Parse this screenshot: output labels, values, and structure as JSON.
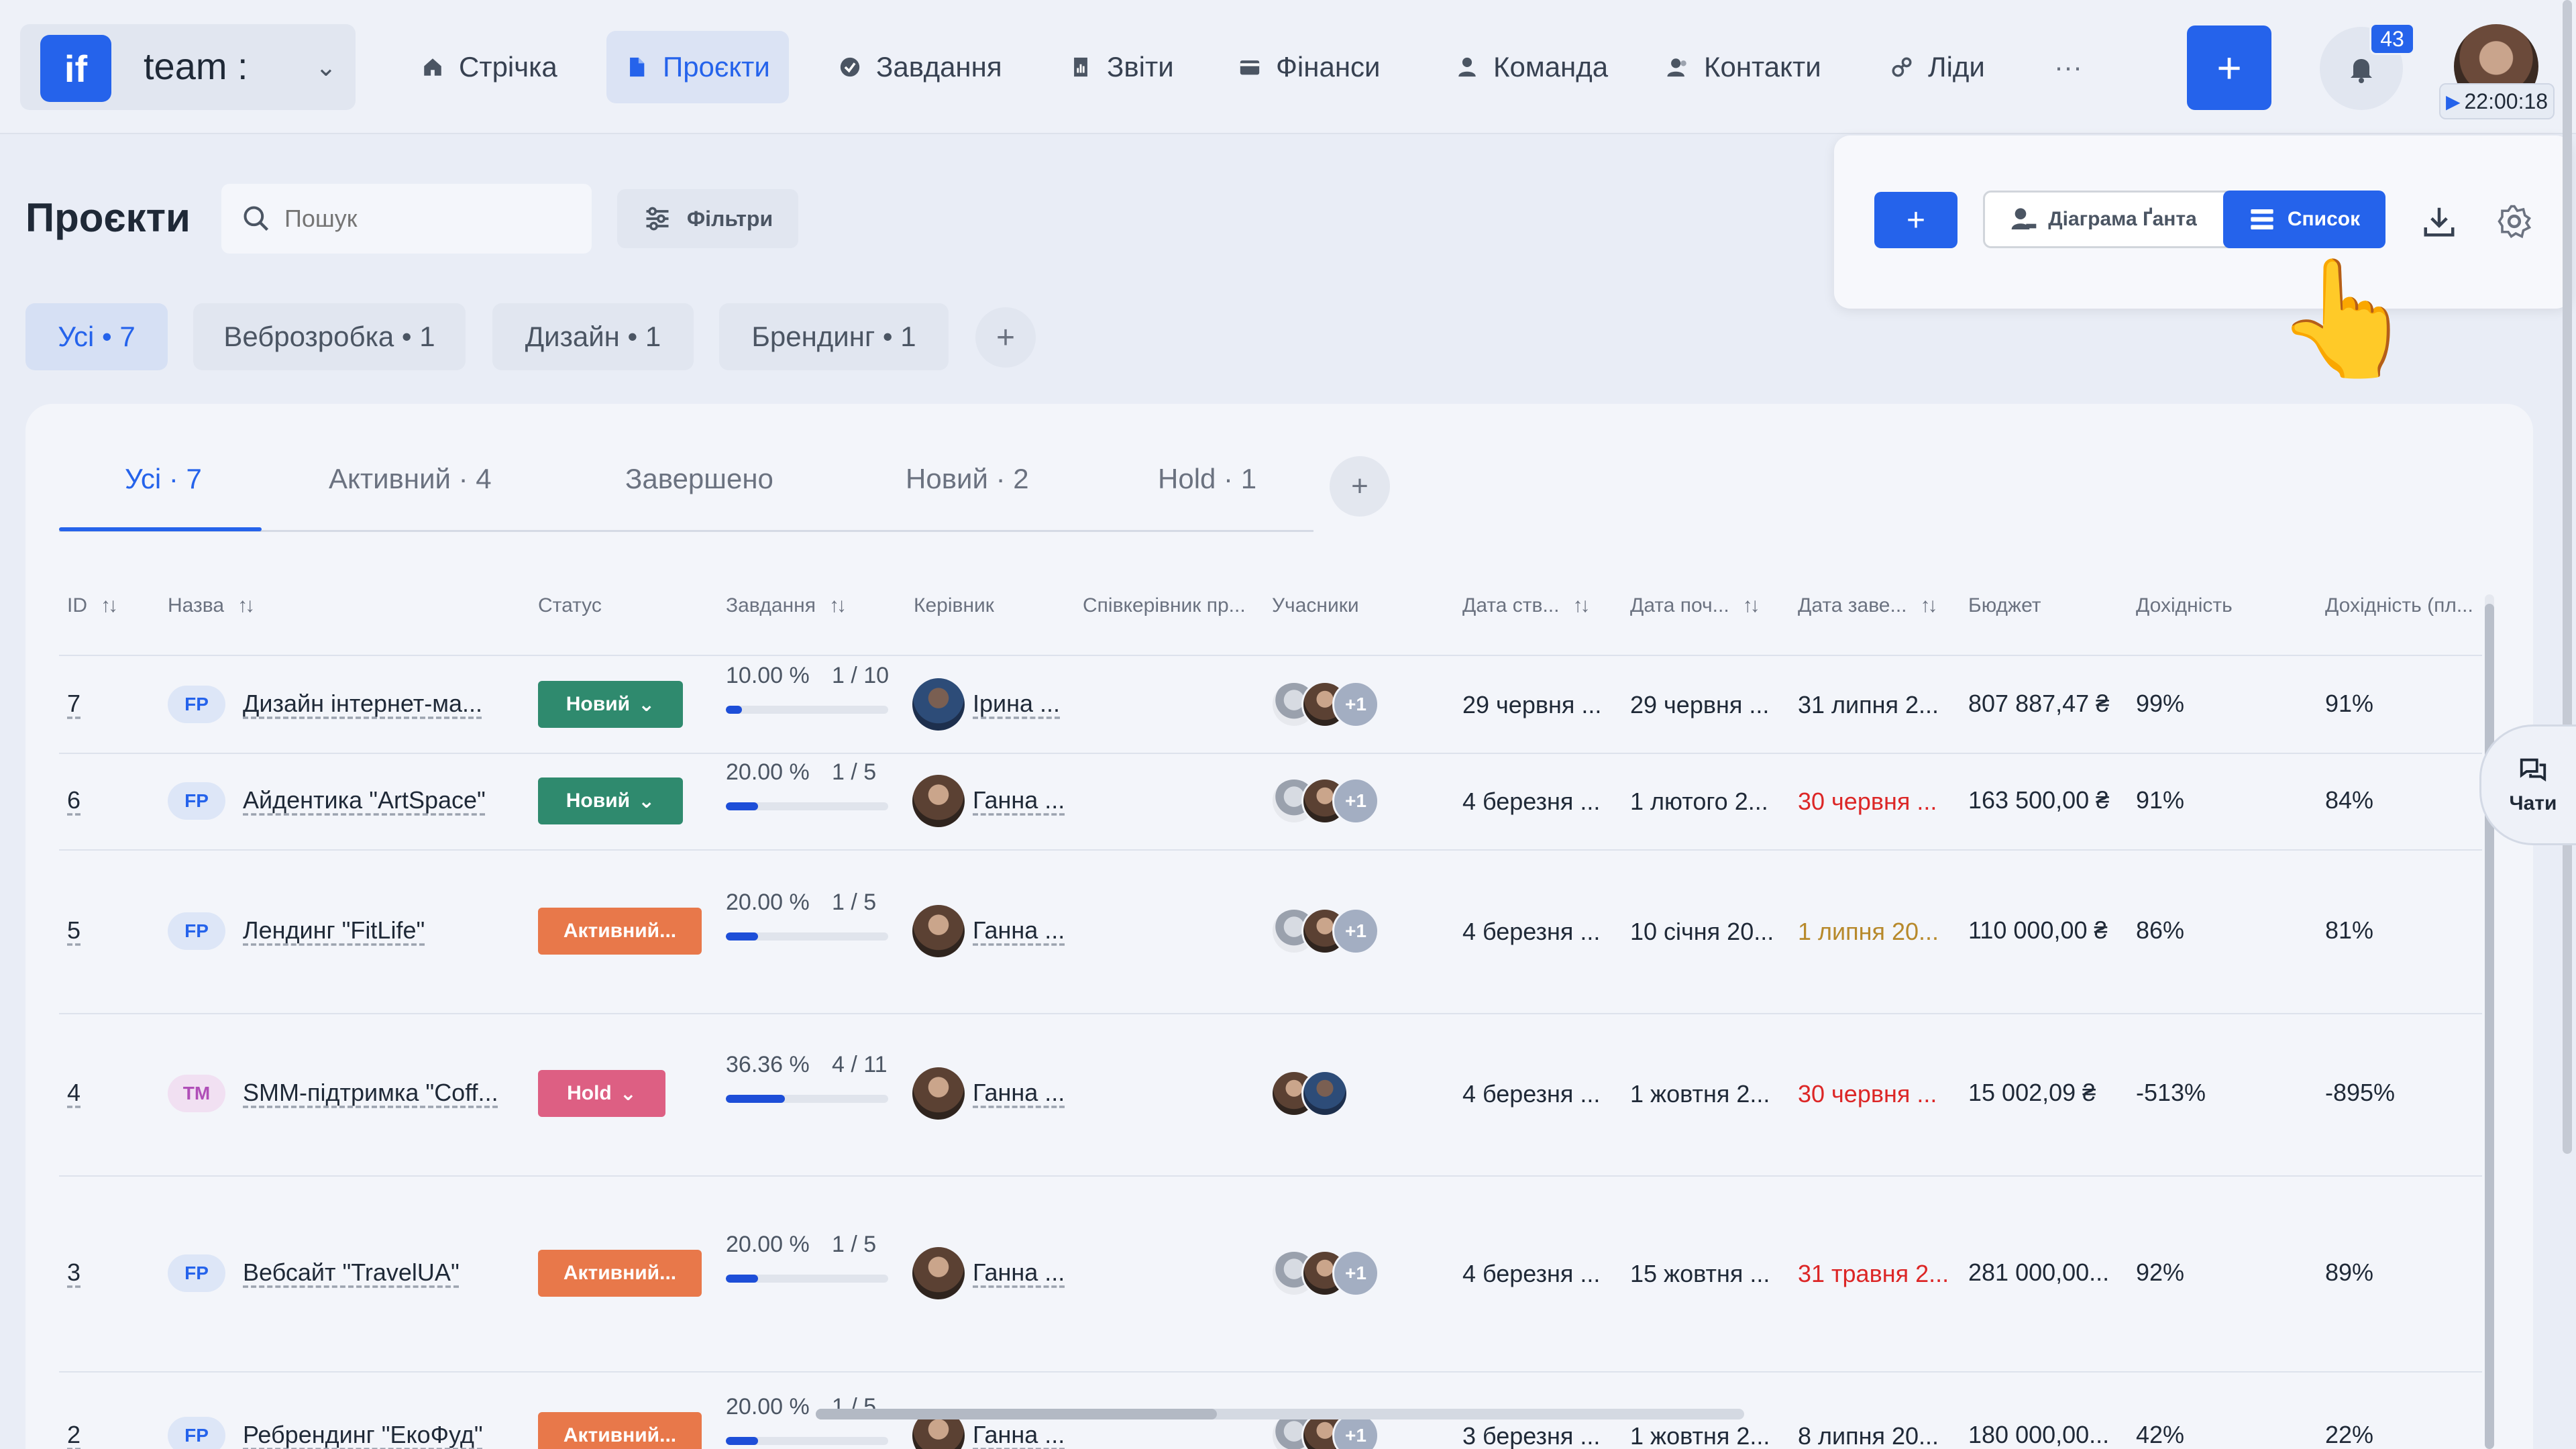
{
  "workspace": {
    "logo": "if",
    "name": "team :"
  },
  "nav": [
    {
      "label": "Стрічка",
      "icon": "home-icon"
    },
    {
      "label": "Проєкти",
      "icon": "document-icon",
      "active": true
    },
    {
      "label": "Завдання",
      "icon": "check-circle-icon"
    },
    {
      "label": "Звіти",
      "icon": "report-icon"
    },
    {
      "label": "Фінанси",
      "icon": "wallet-icon"
    },
    {
      "label": "Команда",
      "icon": "user-icon"
    },
    {
      "label": "Контакти",
      "icon": "contacts-icon"
    },
    {
      "label": "Ліди",
      "icon": "leads-icon"
    },
    {
      "label": "···",
      "icon": "more-icon"
    }
  ],
  "header_right": {
    "add_label": "+",
    "notifications": "43",
    "timer": "22:00:18"
  },
  "page": {
    "title": "Проєкти",
    "search_placeholder": "Пошук",
    "filters_label": "Фільтри",
    "add_label": "+",
    "gantt_label": "Діаграма Ґанта",
    "list_label": "Список"
  },
  "categories": [
    {
      "label": "Усі • 7",
      "active": true
    },
    {
      "label": "Веброзробка • 1"
    },
    {
      "label": "Дизайн • 1"
    },
    {
      "label": "Брендинг • 1"
    }
  ],
  "category_add": "+",
  "status_tabs": [
    {
      "label": "Усі · 7",
      "active": true
    },
    {
      "label": "Активний · 4"
    },
    {
      "label": "Завершено"
    },
    {
      "label": "Новий · 2"
    },
    {
      "label": "Hold · 1"
    }
  ],
  "status_tab_add": "+",
  "columns": [
    "ID",
    "Назва",
    "Статус",
    "Завдання",
    "Керівник",
    "Співкерівник пр...",
    "Учасники",
    "Дата ств...",
    "Дата поч...",
    "Дата заве...",
    "Бюджет",
    "Дохідність",
    "Дохідність (пл..."
  ],
  "rows": [
    {
      "id": "7",
      "tag": "FP",
      "name": "Дизайн інтернет-ма...",
      "status": "Новий",
      "progress_text": "10.00 %",
      "tasks": "1 / 10",
      "progress": 0.1,
      "manager": "Ірина ...",
      "participants_more": "+1",
      "created": "29 червня ...",
      "start": "29 червня ...",
      "end": "31 липня 2...",
      "budget": "807 887,47 ₴",
      "profit": "99%",
      "profit_plan": "91%"
    },
    {
      "id": "6",
      "tag": "FP",
      "name": "Айдентика \"ArtSpace\"",
      "status": "Новий",
      "progress_text": "20.00 %",
      "tasks": "1 / 5",
      "progress": 0.2,
      "manager": "Ганна ...",
      "participants_more": "+1",
      "created": "4 березня ...",
      "start": "1 лютого 2...",
      "end": "30 червня ...",
      "budget": "163 500,00 ₴",
      "profit": "91%",
      "profit_plan": "84%"
    },
    {
      "id": "5",
      "tag": "FP",
      "name": "Лендинг \"FitLife\"",
      "status": "Активний...",
      "progress_text": "20.00 %",
      "tasks": "1 / 5",
      "progress": 0.2,
      "manager": "Ганна ...",
      "participants_more": "+1",
      "created": "4 березня ...",
      "start": "10 січня 20...",
      "end": "1 липня 20...",
      "budget": "110 000,00 ₴",
      "profit": "86%",
      "profit_plan": "81%"
    },
    {
      "id": "4",
      "tag": "TM",
      "name": "SMM-підтримка \"Coff...",
      "status": "Hold",
      "progress_text": "36.36 %",
      "tasks": "4 / 11",
      "progress": 0.3636,
      "manager": "Ганна ...",
      "participants_more": "",
      "created": "4 березня ...",
      "start": "1 жовтня 2...",
      "end": "30 червня ...",
      "budget": "15 002,09 ₴",
      "profit": "-513%",
      "profit_plan": "-895%"
    },
    {
      "id": "3",
      "tag": "FP",
      "name": "Вебсайт \"TravelUA\"",
      "status": "Активний...",
      "progress_text": "20.00 %",
      "tasks": "1 / 5",
      "progress": 0.2,
      "manager": "Ганна ...",
      "participants_more": "+1",
      "created": "4 березня ...",
      "start": "15 жовтня ...",
      "end": "31 травня 2...",
      "budget": "281 000,00...",
      "profit": "92%",
      "profit_plan": "89%"
    },
    {
      "id": "2",
      "tag": "FP",
      "name": "Ребрендинг \"ЕкоФуд\"",
      "status": "Активний...",
      "progress_text": "20.00 %",
      "tasks": "1 / 5",
      "progress": 0.2,
      "manager": "Ганна ...",
      "participants_more": "+1",
      "created": "3 березня ...",
      "start": "1 жовтня 2...",
      "end": "8 липня 20...",
      "budget": "180 000,00...",
      "profit": "42%",
      "profit_plan": "22%"
    }
  ],
  "chats_label": "Чати"
}
